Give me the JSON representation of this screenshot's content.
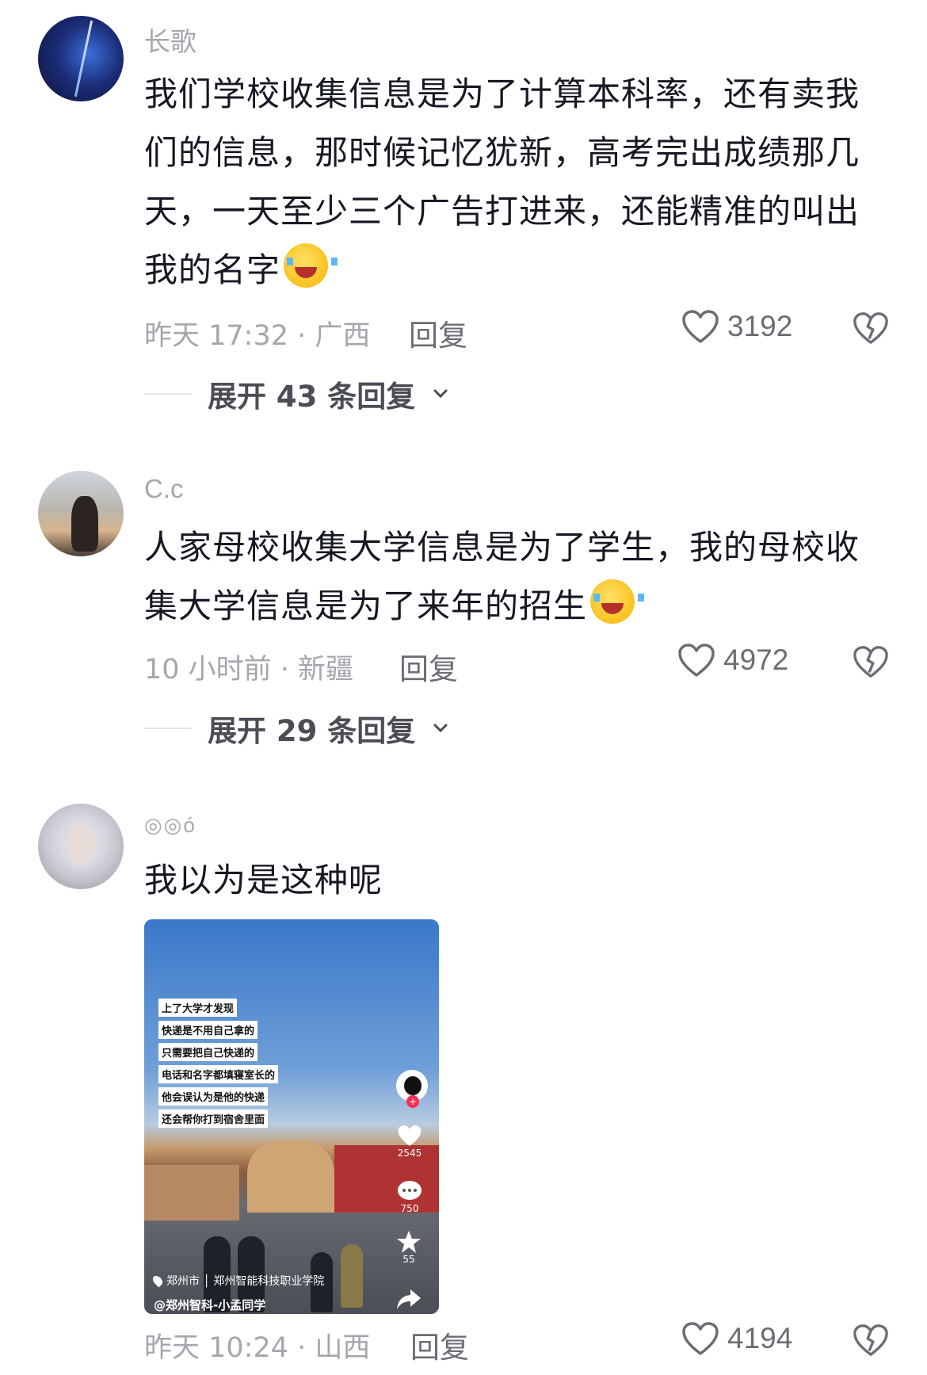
{
  "comments": [
    {
      "username": "长歌",
      "text": "我们学校收集信息是为了计算本科率，还有卖我们的信息，那时候记忆犹新，高考完出成绩那几天，一天至少三个广告打进来，还能精准的叫出我的名字",
      "emoji": "loudly-crying-face",
      "time_location": "昨天 17:32 · 广西",
      "reply_label": "回复",
      "likes": "3192",
      "expand_label": "展开 43 条回复"
    },
    {
      "username": "C.c",
      "text": "人家母校收集大学信息是为了学生，我的母校收集大学信息是为了来年的招生",
      "emoji": "crying-face",
      "time_location": "10 小时前 · 新疆",
      "reply_label": "回复",
      "likes": "4972",
      "expand_label": "展开 29 条回复"
    },
    {
      "username": "◎◎ó",
      "text": "我以为是这种呢",
      "time_location": "昨天 10:24 · 山西",
      "reply_label": "回复",
      "likes": "4194"
    }
  ],
  "video": {
    "captions": [
      "上了大学才发现",
      "快递是不用自己拿的",
      "只需要把自己快递的",
      "电话和名字都填寝室长的",
      "他会误认为是他的快递",
      "还会帮你打到宿舍里面"
    ],
    "likes": "2545",
    "comments": "750",
    "favorites": "55",
    "location": "郑州市 │ 郑州智能科技职业学院",
    "author": "@郑州智科-小孟同学"
  },
  "colors": {
    "text": "#161823",
    "meta": "#a5a7ad",
    "action": "#6b6d74",
    "accent": "#fe2c55"
  }
}
